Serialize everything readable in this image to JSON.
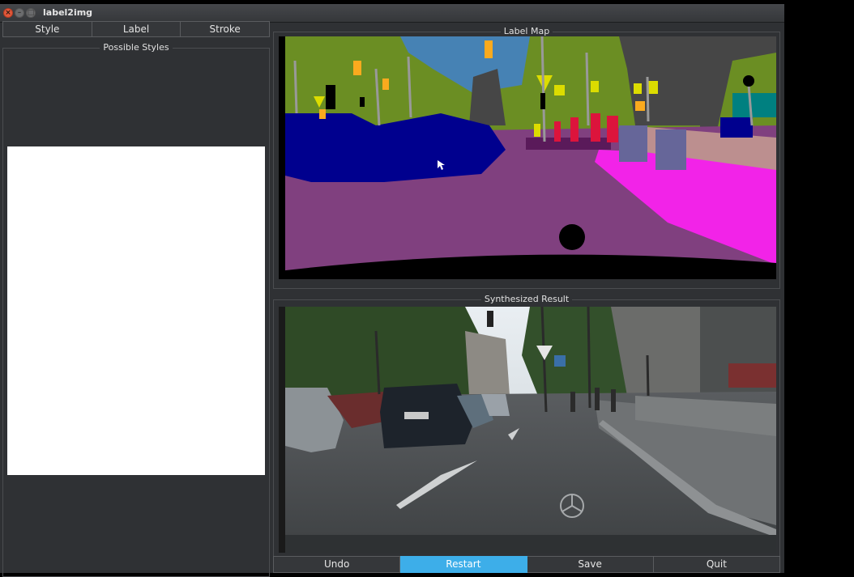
{
  "window": {
    "title": "label2img"
  },
  "tabs": {
    "style": "Style",
    "label": "Label",
    "stroke": "Stroke"
  },
  "panels": {
    "possible_styles": "Possible Styles",
    "label_map": "Label Map",
    "synthesized_result": "Synthesized Result"
  },
  "actions": {
    "undo": "Undo",
    "restart": "Restart",
    "save": "Save",
    "quit": "Quit"
  },
  "colors": {
    "accent": "#3daee9",
    "label_road": "#80407f",
    "label_sidewalk": "#f223e8",
    "label_car": "#00008e",
    "label_vegetation": "#6b8e23",
    "label_sky": "#4682b4",
    "label_building": "#464646",
    "label_traffic_sign": "#dcdc00",
    "label_traffic_light": "#faaa1e",
    "label_person": "#dc143c",
    "label_pole": "#999999"
  }
}
